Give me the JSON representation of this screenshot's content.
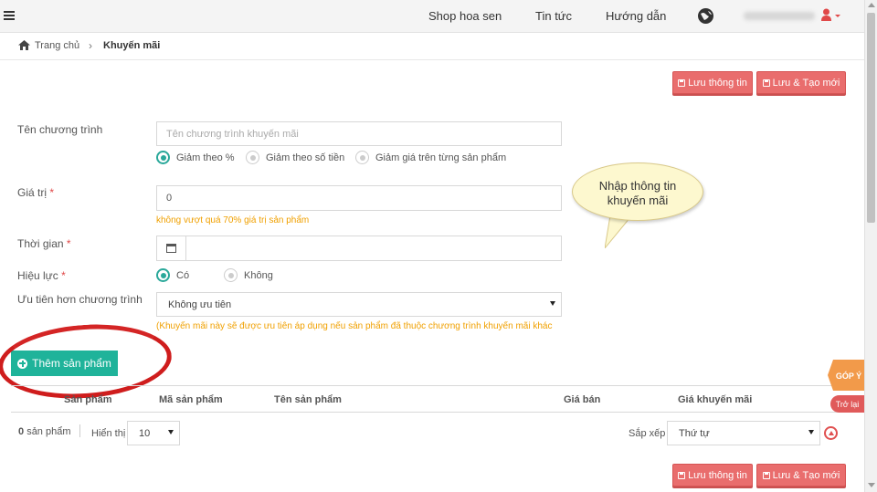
{
  "topbar": {
    "nav": [
      "Shop hoa sen",
      "Tin tức",
      "Hướng dẫn"
    ]
  },
  "breadcrumb": {
    "home": "Trang chủ",
    "current": "Khuyến mãi"
  },
  "actions": {
    "save": "Lưu thông tin",
    "save_new": "Lưu & Tạo mới"
  },
  "form": {
    "name_label": "Tên chương trình",
    "name_placeholder": "Tên chương trình khuyến mãi",
    "discount_types": [
      "Giảm theo %",
      "Giảm theo số tiền",
      "Giảm giá trên từng sản phẩm"
    ],
    "value_label": "Giá trị",
    "value": "0",
    "value_hint": "không vượt quá 70% giá trị sản phẩm",
    "time_label": "Thời gian",
    "active_label": "Hiệu lực",
    "active_options": [
      "Có",
      "Không"
    ],
    "priority_label": "Ưu tiên hơn chương trình",
    "priority_value": "Không ưu tiên",
    "priority_hint": "(Khuyến mãi này sẽ được ưu tiên áp dụng nếu sản phẩm đã thuộc chương trình khuyến mãi khác",
    "required_mark": "*"
  },
  "callout": {
    "line1": "Nhập thông tin",
    "line2": "khuyến mãi"
  },
  "products": {
    "add_button": "Thêm sản phẩm",
    "columns": [
      "Sản phẩm",
      "Mã sản phẩm",
      "Tên sản phẩm",
      "Giá bán",
      "Giá khuyến mãi"
    ],
    "count": "0",
    "count_suffix": "sản phẩm",
    "show_label": "Hiển thị",
    "page_size": "10",
    "sort_label": "Sắp xếp",
    "sort_value": "Thứ tự"
  },
  "side": {
    "feedback": "GÓP Ý",
    "back": "Trở lại"
  },
  "colors": {
    "accent": "#1fb39a",
    "danger": "#e96d6d",
    "hint": "#f0a000"
  }
}
